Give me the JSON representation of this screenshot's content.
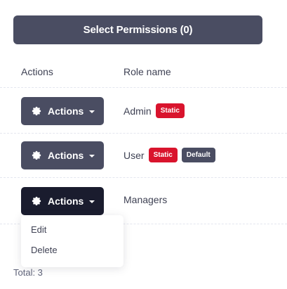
{
  "toolbar": {
    "select_permissions_label": "Select Permissions (0)"
  },
  "table": {
    "headers": {
      "actions": "Actions",
      "role_name": "Role name"
    },
    "rows": [
      {
        "action_label": "Actions",
        "role": "Admin",
        "badges": [
          "Static"
        ]
      },
      {
        "action_label": "Actions",
        "role": "User",
        "badges": [
          "Static",
          "Default"
        ]
      },
      {
        "action_label": "Actions",
        "role": "Managers",
        "badges": []
      }
    ]
  },
  "dropdown": {
    "items": [
      "Edit",
      "Delete"
    ]
  },
  "footer": {
    "total": "Total: 3"
  },
  "colors": {
    "button": "#4a4d62",
    "button_active": "#1a1c2e",
    "static_badge": "#d9142d",
    "default_badge": "#4a4d62"
  },
  "icons": {
    "action_icon": "gear-icon",
    "dropdown_icon": "caret-down-icon"
  }
}
